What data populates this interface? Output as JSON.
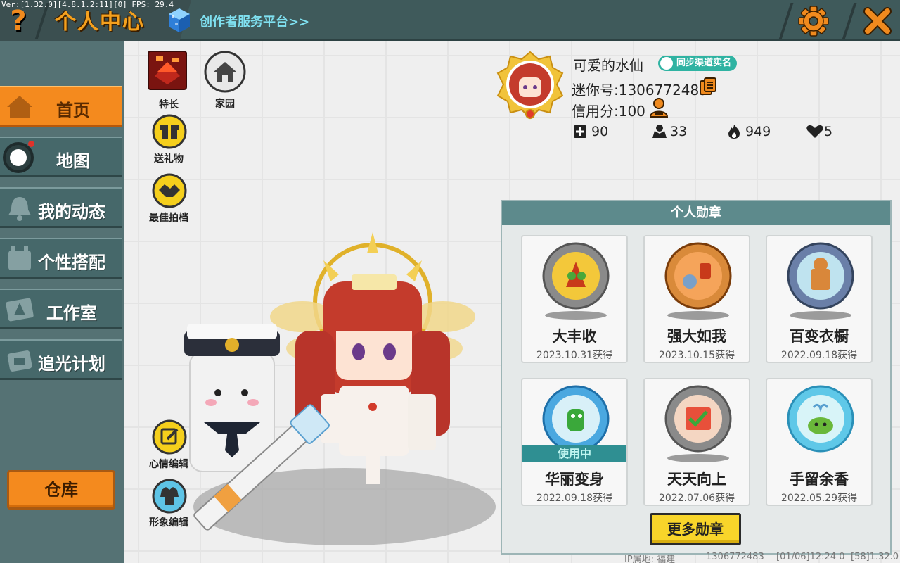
{
  "debug_overlay": "Ver:[1.32.0][4.8.1.2:11][0] FPS: 29.4",
  "header": {
    "title": "个人中心",
    "creator_link": "创作者服务平台>>",
    "help_icon": "question-mark-icon",
    "settings_icon": "gear-icon",
    "close_icon": "close-x-icon"
  },
  "sidebar": {
    "items": [
      {
        "label": "首页",
        "icon": "house-icon",
        "active": true
      },
      {
        "label": "地图",
        "icon": "map-record-icon",
        "active": false,
        "has_notification": true
      },
      {
        "label": "我的动态",
        "icon": "bell-icon",
        "active": false
      },
      {
        "label": "个性搭配",
        "icon": "outfit-icon",
        "active": false
      },
      {
        "label": "工作室",
        "icon": "studio-icon",
        "active": false
      },
      {
        "label": "追光计划",
        "icon": "spotlight-icon",
        "active": false
      }
    ],
    "warehouse_label": "仓库"
  },
  "side_actions": {
    "specialty": "特长",
    "home": "家园",
    "gift": "送礼物",
    "best_partner": "最佳拍档",
    "mood_edit": "心情编辑",
    "appearance_edit": "形象编辑"
  },
  "profile": {
    "username": "可爱的水仙",
    "realname_badge": "同步渠道实名",
    "mini_id": "迷你号:1306772483",
    "credit": "信用分:100",
    "stats": {
      "plus": "90",
      "fans": "33",
      "fire": "949",
      "likes": "5"
    }
  },
  "medals": {
    "title": "个人勋章",
    "in_use_label": "使用中",
    "items": [
      {
        "name": "大丰收",
        "date": "2023.10.31获得",
        "ring": "stone"
      },
      {
        "name": "强大如我",
        "date": "2023.10.15获得",
        "ring": "wood"
      },
      {
        "name": "百变衣橱",
        "date": "2022.09.18获得",
        "ring": "steel"
      },
      {
        "name": "华丽变身",
        "date": "2022.09.18获得",
        "ring": "crystal",
        "in_use": true
      },
      {
        "name": "天天向上",
        "date": "2022.07.06获得",
        "ring": "stone"
      },
      {
        "name": "手留余香",
        "date": "2022.05.29获得",
        "ring": "crystal"
      }
    ],
    "more_button": "更多勋章"
  },
  "footer": {
    "ip_location": "IP属地: 福建",
    "uid": "1306772483",
    "time": "[01/06]12:24 0",
    "build": "[58]1.32.0"
  },
  "colors": {
    "accent_orange": "#f48a1e",
    "sidebar_teal": "#46686a",
    "header_dark": "#3f5a5b",
    "medal_header": "#5d8a8c",
    "button_yellow": "#f8d52a"
  }
}
